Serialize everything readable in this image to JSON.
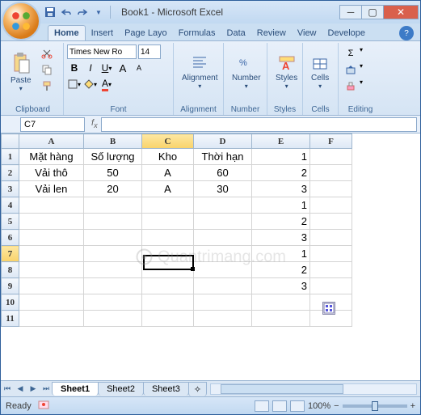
{
  "title": "Book1 - Microsoft Excel",
  "tabs": [
    "Home",
    "Insert",
    "Page Layo",
    "Formulas",
    "Data",
    "Review",
    "View",
    "Develope"
  ],
  "active_tab": 0,
  "ribbon": {
    "clipboard": {
      "label": "Clipboard",
      "paste": "Paste"
    },
    "font": {
      "label": "Font",
      "name": "Times New Ro",
      "size": "14"
    },
    "alignment": {
      "label": "Alignment",
      "btn": "Alignment"
    },
    "number": {
      "label": "Number",
      "btn": "Number"
    },
    "styles": {
      "label": "Styles",
      "btn": "Styles"
    },
    "cells": {
      "label": "Cells",
      "btn": "Cells"
    },
    "editing": {
      "label": "Editing"
    }
  },
  "namebox": "C7",
  "grid": {
    "cols": [
      "A",
      "B",
      "C",
      "D",
      "E",
      "F"
    ],
    "rows": [
      "1",
      "2",
      "3",
      "4",
      "5",
      "6",
      "7",
      "8",
      "9",
      "10",
      "11"
    ],
    "active_col": 2,
    "active_row": 6,
    "data": [
      [
        "Mặt hàng",
        "Số lượng",
        "Kho",
        "Thời hạn",
        "1",
        ""
      ],
      [
        "Vải thô",
        "50",
        "A",
        "60",
        "2",
        ""
      ],
      [
        "Vải len",
        "20",
        "A",
        "30",
        "3",
        ""
      ],
      [
        "",
        "",
        "",
        "",
        "1",
        ""
      ],
      [
        "",
        "",
        "",
        "",
        "2",
        ""
      ],
      [
        "",
        "",
        "",
        "",
        "3",
        ""
      ],
      [
        "",
        "",
        "",
        "",
        "1",
        ""
      ],
      [
        "",
        "",
        "",
        "",
        "2",
        ""
      ],
      [
        "",
        "",
        "",
        "",
        "3",
        ""
      ],
      [
        "",
        "",
        "",
        "",
        "",
        ""
      ],
      [
        "",
        "",
        "",
        "",
        "",
        ""
      ]
    ],
    "align": [
      [
        "c",
        "c",
        "c",
        "c",
        "r",
        ""
      ],
      [
        "c",
        "c",
        "c",
        "c",
        "r",
        ""
      ],
      [
        "c",
        "c",
        "c",
        "c",
        "r",
        ""
      ],
      [
        "",
        "",
        "",
        "",
        "r",
        ""
      ],
      [
        "",
        "",
        "",
        "",
        "r",
        ""
      ],
      [
        "",
        "",
        "",
        "",
        "r",
        ""
      ],
      [
        "",
        "",
        "",
        "",
        "r",
        ""
      ],
      [
        "",
        "",
        "",
        "",
        "r",
        ""
      ],
      [
        "",
        "",
        "",
        "",
        "r",
        ""
      ],
      [
        "",
        "",
        "",
        "",
        "",
        ""
      ],
      [
        "",
        "",
        "",
        "",
        "",
        ""
      ]
    ]
  },
  "sheets": [
    "Sheet1",
    "Sheet2",
    "Sheet3"
  ],
  "active_sheet": 0,
  "status": {
    "ready": "Ready",
    "zoom": "100%"
  },
  "watermark": "Quantrimang.com"
}
